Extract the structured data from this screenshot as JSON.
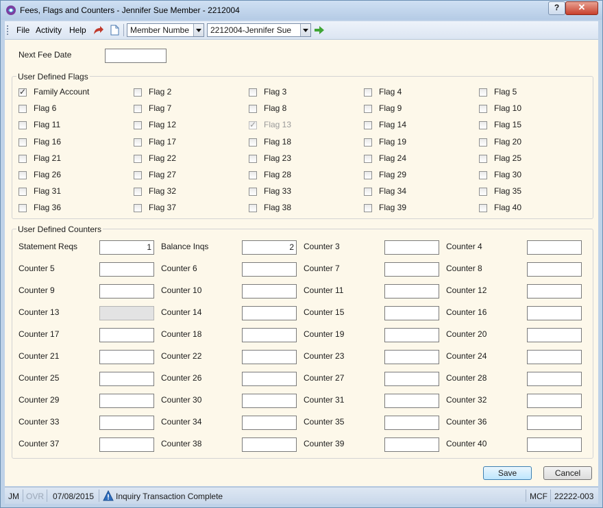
{
  "window": {
    "title": "Fees, Flags and Counters - Jennifer Sue Member - 2212004",
    "help": "?",
    "close": "✕"
  },
  "menu": {
    "file": "File",
    "activity": "Activity",
    "help": "Help"
  },
  "toolbar": {
    "lookup_type": "Member Numbe",
    "member": "2212004-Jennifer Sue"
  },
  "next_fee": {
    "label": "Next Fee Date",
    "value": ""
  },
  "flags": {
    "title": "User Defined Flags",
    "items": [
      {
        "label": "Family Account",
        "checked": true,
        "disabled": false
      },
      {
        "label": "Flag 2",
        "checked": false,
        "disabled": false
      },
      {
        "label": "Flag 3",
        "checked": false,
        "disabled": false
      },
      {
        "label": "Flag 4",
        "checked": false,
        "disabled": false
      },
      {
        "label": "Flag 5",
        "checked": false,
        "disabled": false
      },
      {
        "label": "Flag 6",
        "checked": false,
        "disabled": false
      },
      {
        "label": "Flag 7",
        "checked": false,
        "disabled": false
      },
      {
        "label": "Flag 8",
        "checked": false,
        "disabled": false
      },
      {
        "label": "Flag 9",
        "checked": false,
        "disabled": false
      },
      {
        "label": "Flag 10",
        "checked": false,
        "disabled": false
      },
      {
        "label": "Flag 11",
        "checked": false,
        "disabled": false
      },
      {
        "label": "Flag 12",
        "checked": false,
        "disabled": false
      },
      {
        "label": "Flag 13",
        "checked": true,
        "disabled": true
      },
      {
        "label": "Flag 14",
        "checked": false,
        "disabled": false
      },
      {
        "label": "Flag 15",
        "checked": false,
        "disabled": false
      },
      {
        "label": "Flag 16",
        "checked": false,
        "disabled": false
      },
      {
        "label": "Flag 17",
        "checked": false,
        "disabled": false
      },
      {
        "label": "Flag 18",
        "checked": false,
        "disabled": false
      },
      {
        "label": "Flag 19",
        "checked": false,
        "disabled": false
      },
      {
        "label": "Flag 20",
        "checked": false,
        "disabled": false
      },
      {
        "label": "Flag 21",
        "checked": false,
        "disabled": false
      },
      {
        "label": "Flag 22",
        "checked": false,
        "disabled": false
      },
      {
        "label": "Flag 23",
        "checked": false,
        "disabled": false
      },
      {
        "label": "Flag 24",
        "checked": false,
        "disabled": false
      },
      {
        "label": "Flag 25",
        "checked": false,
        "disabled": false
      },
      {
        "label": "Flag 26",
        "checked": false,
        "disabled": false
      },
      {
        "label": "Flag 27",
        "checked": false,
        "disabled": false
      },
      {
        "label": "Flag 28",
        "checked": false,
        "disabled": false
      },
      {
        "label": "Flag 29",
        "checked": false,
        "disabled": false
      },
      {
        "label": "Flag 30",
        "checked": false,
        "disabled": false
      },
      {
        "label": "Flag 31",
        "checked": false,
        "disabled": false
      },
      {
        "label": "Flag 32",
        "checked": false,
        "disabled": false
      },
      {
        "label": "Flag 33",
        "checked": false,
        "disabled": false
      },
      {
        "label": "Flag 34",
        "checked": false,
        "disabled": false
      },
      {
        "label": "Flag 35",
        "checked": false,
        "disabled": false
      },
      {
        "label": "Flag 36",
        "checked": false,
        "disabled": false
      },
      {
        "label": "Flag 37",
        "checked": false,
        "disabled": false
      },
      {
        "label": "Flag 38",
        "checked": false,
        "disabled": false
      },
      {
        "label": "Flag 39",
        "checked": false,
        "disabled": false
      },
      {
        "label": "Flag 40",
        "checked": false,
        "disabled": false
      }
    ]
  },
  "counters": {
    "title": "User Defined Counters",
    "items": [
      {
        "label": "Statement Reqs",
        "value": "1",
        "disabled": false
      },
      {
        "label": "Balance Inqs",
        "value": "2",
        "disabled": false
      },
      {
        "label": "Counter 3",
        "value": "",
        "disabled": false
      },
      {
        "label": "Counter 4",
        "value": "",
        "disabled": false
      },
      {
        "label": "Counter 5",
        "value": "",
        "disabled": false
      },
      {
        "label": "Counter 6",
        "value": "",
        "disabled": false
      },
      {
        "label": "Counter 7",
        "value": "",
        "disabled": false
      },
      {
        "label": "Counter 8",
        "value": "",
        "disabled": false
      },
      {
        "label": "Counter 9",
        "value": "",
        "disabled": false
      },
      {
        "label": "Counter 10",
        "value": "",
        "disabled": false
      },
      {
        "label": "Counter 11",
        "value": "",
        "disabled": false
      },
      {
        "label": "Counter 12",
        "value": "",
        "disabled": false
      },
      {
        "label": "Counter 13",
        "value": "",
        "disabled": true
      },
      {
        "label": "Counter 14",
        "value": "",
        "disabled": false
      },
      {
        "label": "Counter 15",
        "value": "",
        "disabled": false
      },
      {
        "label": "Counter 16",
        "value": "",
        "disabled": false
      },
      {
        "label": "Counter 17",
        "value": "",
        "disabled": false
      },
      {
        "label": "Counter 18",
        "value": "",
        "disabled": false
      },
      {
        "label": "Counter 19",
        "value": "",
        "disabled": false
      },
      {
        "label": "Counter 20",
        "value": "",
        "disabled": false
      },
      {
        "label": "Counter 21",
        "value": "",
        "disabled": false
      },
      {
        "label": "Counter 22",
        "value": "",
        "disabled": false
      },
      {
        "label": "Counter 23",
        "value": "",
        "disabled": false
      },
      {
        "label": "Counter 24",
        "value": "",
        "disabled": false
      },
      {
        "label": "Counter 25",
        "value": "",
        "disabled": false
      },
      {
        "label": "Counter 26",
        "value": "",
        "disabled": false
      },
      {
        "label": "Counter 27",
        "value": "",
        "disabled": false
      },
      {
        "label": "Counter 28",
        "value": "",
        "disabled": false
      },
      {
        "label": "Counter 29",
        "value": "",
        "disabled": false
      },
      {
        "label": "Counter 30",
        "value": "",
        "disabled": false
      },
      {
        "label": "Counter 31",
        "value": "",
        "disabled": false
      },
      {
        "label": "Counter 32",
        "value": "",
        "disabled": false
      },
      {
        "label": "Counter 33",
        "value": "",
        "disabled": false
      },
      {
        "label": "Counter 34",
        "value": "",
        "disabled": false
      },
      {
        "label": "Counter 35",
        "value": "",
        "disabled": false
      },
      {
        "label": "Counter 36",
        "value": "",
        "disabled": false
      },
      {
        "label": "Counter 37",
        "value": "",
        "disabled": false
      },
      {
        "label": "Counter 38",
        "value": "",
        "disabled": false
      },
      {
        "label": "Counter 39",
        "value": "",
        "disabled": false
      },
      {
        "label": "Counter 40",
        "value": "",
        "disabled": false
      }
    ]
  },
  "buttons": {
    "save": "Save",
    "cancel": "Cancel"
  },
  "status": {
    "user": "JM",
    "ovr": "OVR",
    "date": "07/08/2015",
    "message": "Inquiry Transaction Complete",
    "module": "MCF",
    "code": "22222-003"
  },
  "colors": {
    "background": "#fdf8ea",
    "chrome": "#bfd2e8",
    "redo_arrow": "#c0392b",
    "go_arrow": "#3fa535"
  },
  "icons": {
    "app": "app-logo-icon",
    "redo": "redo-arrow-icon",
    "new": "new-document-icon",
    "go": "go-arrow-icon",
    "warning": "info-triangle-icon"
  }
}
